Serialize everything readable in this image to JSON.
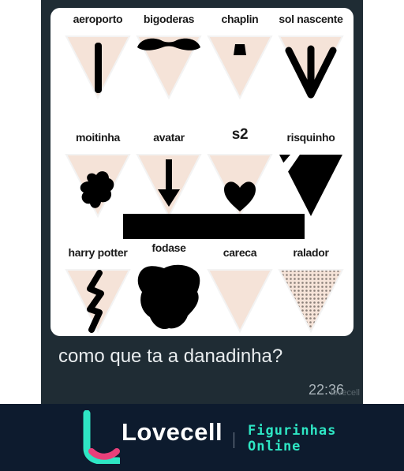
{
  "sticker": {
    "labels": [
      "aeroporto",
      "bigoderas",
      "chaplin",
      "sol nascente",
      "moitinha",
      "avatar",
      "s2",
      "risquinho",
      "harry potter",
      "fodase",
      "careca",
      "ralador"
    ]
  },
  "message": {
    "text": "como que ta a danadinha?",
    "time": "22:36",
    "watermark": "lovecell"
  },
  "footer": {
    "brand": "Lovecell",
    "tagline_line1": "Figurinhas",
    "tagline_line2": "Online",
    "logo_icon": "lovecell-logo-icon"
  },
  "colors": {
    "chat_bg": "#1f2c34",
    "footer_bg": "#0d1b2e",
    "accent_teal": "#2ee6c4",
    "accent_pink": "#e8407a",
    "skin": "#f5e3d8"
  }
}
